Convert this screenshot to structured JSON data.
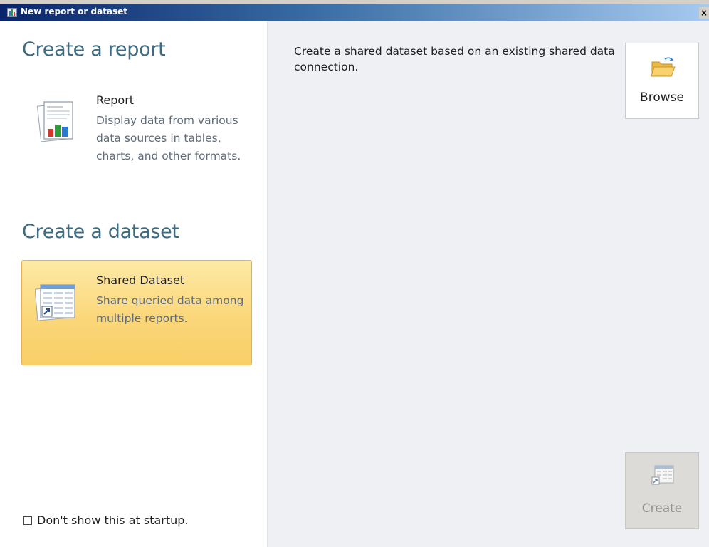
{
  "window": {
    "title": "New report or dataset",
    "close_glyph": "×",
    "icon": "report-app-icon"
  },
  "left": {
    "report_section": {
      "heading": "Create a report",
      "option": {
        "title": "Report",
        "description": "Display data from various data sources in tables, charts, and other formats.",
        "icon": "report-icon",
        "selected": false
      }
    },
    "dataset_section": {
      "heading": "Create a dataset",
      "option": {
        "title": "Shared Dataset",
        "description": "Share queried data among multiple reports.",
        "icon": "shared-dataset-icon",
        "selected": true
      }
    },
    "startup_checkbox": {
      "label": "Don't show this at startup.",
      "checked": false
    }
  },
  "right": {
    "description": "Create a shared dataset based on an existing shared data connection.",
    "browse_button": {
      "label": "Browse",
      "icon": "folder-open-icon"
    },
    "create_button": {
      "label": "Create",
      "icon": "create-dataset-icon",
      "enabled": false
    }
  },
  "colors": {
    "heading": "#3d6b82",
    "selected_fill": "#fbd77a",
    "selected_border": "#e2b34d",
    "right_pane": "#eff0f3",
    "disabled_text": "#8f9092"
  }
}
